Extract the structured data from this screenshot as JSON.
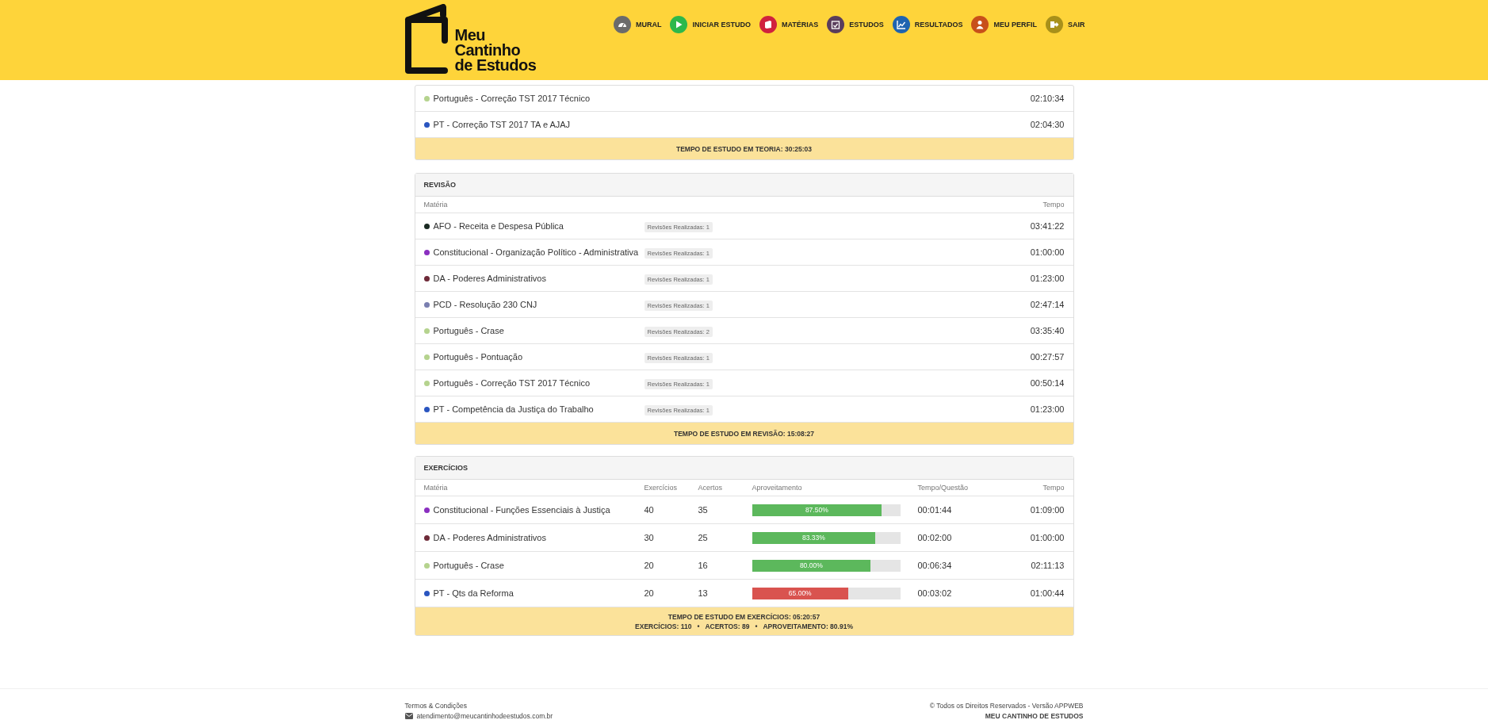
{
  "logo": {
    "lines": [
      "Meu",
      "Cantinho",
      "de Estudos"
    ]
  },
  "nav": [
    {
      "label": "MURAL",
      "color": "#6b6b6b"
    },
    {
      "label": "INICIAR ESTUDO",
      "color": "#2db84b"
    },
    {
      "label": "MATÉRIAS",
      "color": "#d0213e"
    },
    {
      "label": "ESTUDOS",
      "color": "#5a3d5c"
    },
    {
      "label": "RESULTADOS",
      "color": "#1f64b0"
    },
    {
      "label": "MEU PERFIL",
      "color": "#c8501a"
    },
    {
      "label": "SAIR",
      "color": "#a8901a"
    }
  ],
  "theory": {
    "rows": [
      {
        "subject": "Português - Correção TST 2017 Técnico",
        "color": "#b5d38e",
        "time": "02:10:34"
      },
      {
        "subject": "PT - Correção TST 2017 TA e AJAJ",
        "color": "#2a55c0",
        "time": "02:04:30"
      }
    ],
    "total": "TEMPO DE ESTUDO EM TEORIA: 30:25:03"
  },
  "revision": {
    "title": "REVISÃO",
    "columns": [
      "Matéria",
      "Tempo"
    ],
    "rows": [
      {
        "subject": "AFO - Receita e Despesa Pública",
        "color": "#1a2a22",
        "badge": "Revisões Realizadas: 1",
        "time": "03:41:22"
      },
      {
        "subject": "Constitucional - Organização Político - Administrativa",
        "color": "#8a2fc0",
        "badge": "Revisões Realizadas: 1",
        "time": "01:00:00"
      },
      {
        "subject": "DA - Poderes Administrativos",
        "color": "#6e2a38",
        "badge": "Revisões Realizadas: 1",
        "time": "01:23:00"
      },
      {
        "subject": "PCD - Resolução 230 CNJ",
        "color": "#7a7fb0",
        "badge": "Revisões Realizadas: 1",
        "time": "02:47:14"
      },
      {
        "subject": "Português - Crase",
        "color": "#b5d38e",
        "badge": "Revisões Realizadas: 2",
        "time": "03:35:40"
      },
      {
        "subject": "Português - Pontuação",
        "color": "#b5d38e",
        "badge": "Revisões Realizadas: 1",
        "time": "00:27:57"
      },
      {
        "subject": "Português - Correção TST 2017 Técnico",
        "color": "#b5d38e",
        "badge": "Revisões Realizadas: 1",
        "time": "00:50:14"
      },
      {
        "subject": "PT - Competência da Justiça do Trabalho",
        "color": "#2a55c0",
        "badge": "Revisões Realizadas: 1",
        "time": "01:23:00"
      }
    ],
    "total": "TEMPO DE ESTUDO EM REVISÃO: 15:08:27"
  },
  "exercises": {
    "title": "EXERCÍCIOS",
    "columns": [
      "Matéria",
      "Exercícios",
      "Acertos",
      "Aproveitamento",
      "Tempo/Questão",
      "Tempo"
    ],
    "rows": [
      {
        "subject": "Constitucional - Funções Essenciais à Justiça",
        "color": "#8a2fc0",
        "exercises": "40",
        "correct": "35",
        "level": 0.875,
        "percent": "87.50%",
        "per_question": "00:01:44",
        "time": "01:09:00"
      },
      {
        "subject": "DA - Poderes Administrativos",
        "color": "#6e2a38",
        "exercises": "30",
        "correct": "25",
        "level": 0.8333,
        "percent": "83.33%",
        "per_question": "00:02:00",
        "time": "01:00:00"
      },
      {
        "subject": "Português - Crase",
        "color": "#b5d38e",
        "exercises": "20",
        "correct": "16",
        "level": 0.8,
        "percent": "80.00%",
        "per_question": "00:06:34",
        "time": "02:11:13"
      },
      {
        "subject": "PT - Qts da Reforma",
        "color": "#2a55c0",
        "exercises": "20",
        "correct": "13",
        "level": 0.65,
        "percent": "65.00%",
        "per_question": "00:03:02",
        "time": "01:00:44"
      }
    ],
    "total": "TEMPO DE ESTUDO EM EXERCÍCIOS: 05:20:57",
    "summary": [
      "EXERCÍCIOS: 110",
      "ACERTOS: 89",
      "APROVEITAMENTO: 80.91%"
    ],
    "separator": "•"
  },
  "footer": {
    "terms": "Termos & Condições",
    "email": "atendimento@meucantinhodeestudos.com.br",
    "rights": "© Todos os Direitos Reservados - Versão APPWEB",
    "brand": "MEU CANTINHO DE ESTUDOS"
  }
}
